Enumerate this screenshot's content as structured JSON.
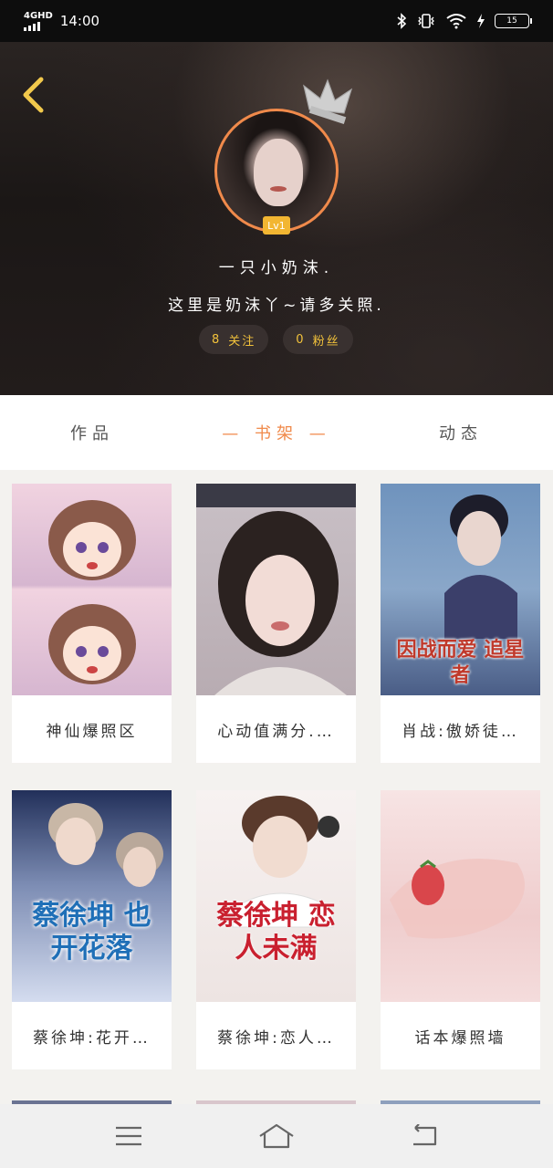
{
  "status_bar": {
    "network": "4GHD",
    "time": "14:00",
    "battery": "15"
  },
  "profile": {
    "level": "Lv1",
    "username": "一只小奶沫.",
    "bio": "这里是奶沫丫~请多关照.",
    "following_count": "8",
    "following_label": "关注",
    "followers_count": "0",
    "followers_label": "粉丝"
  },
  "tabs": [
    {
      "label": "作品",
      "active": false
    },
    {
      "label": "— 书架 —",
      "active": true
    },
    {
      "label": "动态",
      "active": false
    }
  ],
  "books": [
    {
      "title": "神仙爆照区",
      "cover_text": "",
      "cover_colors": [
        "#e9c6d8",
        "#c9a7c7"
      ]
    },
    {
      "title": "心动值满分.…",
      "cover_text": "",
      "cover_colors": [
        "#d9d0d6",
        "#8c7f86"
      ]
    },
    {
      "title": "肖战:傲娇徒…",
      "cover_text": "因战而爱 追星者",
      "cover_colors": [
        "#7ea3c9",
        "#3d4f74"
      ]
    },
    {
      "title": "蔡徐坤:花开…",
      "cover_text": "蔡徐坤 也开花落",
      "cover_colors": [
        "#c8d4ea",
        "#7f8fb3"
      ]
    },
    {
      "title": "蔡徐坤:恋人…",
      "cover_text": "蔡徐坤 恋人未满",
      "cover_colors": [
        "#f4ecea",
        "#e6d9d5"
      ]
    },
    {
      "title": "话本爆照墙",
      "cover_text": "",
      "cover_colors": [
        "#f5dcdc",
        "#e7bcbc"
      ]
    }
  ],
  "colors": {
    "accent": "#f08a4b",
    "stat_text": "#f2c23b",
    "level_badge": "#f2b632",
    "back_arrow": "#f2c94c"
  },
  "icons": {
    "back": "chevron-left-icon",
    "menu": "menu-icon",
    "home": "home-icon",
    "return": "return-icon"
  }
}
